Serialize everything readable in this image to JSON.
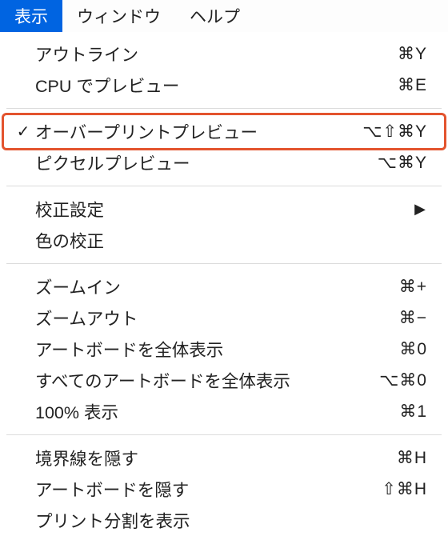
{
  "menubar": {
    "items": [
      {
        "label": "表示",
        "active": true
      },
      {
        "label": "ウィンドウ",
        "active": false
      },
      {
        "label": "ヘルプ",
        "active": false
      }
    ]
  },
  "menu": {
    "groups": [
      [
        {
          "label": "アウトライン",
          "shortcut": "⌘Y"
        },
        {
          "label": "CPU でプレビュー",
          "shortcut": "⌘E"
        }
      ],
      [
        {
          "label": "オーバープリントプレビュー",
          "shortcut": "⌥⇧⌘Y",
          "checked": true,
          "highlight": true
        },
        {
          "label": "ピクセルプレビュー",
          "shortcut": "⌥⌘Y"
        }
      ],
      [
        {
          "label": "校正設定",
          "submenu": true
        },
        {
          "label": "色の校正"
        }
      ],
      [
        {
          "label": "ズームイン",
          "shortcut": "⌘+"
        },
        {
          "label": "ズームアウト",
          "shortcut": "⌘−"
        },
        {
          "label": "アートボードを全体表示",
          "shortcut": "⌘0"
        },
        {
          "label": "すべてのアートボードを全体表示",
          "shortcut": "⌥⌘0"
        },
        {
          "label": "100% 表示",
          "shortcut": "⌘1"
        }
      ],
      [
        {
          "label": "境界線を隠す",
          "shortcut": "⌘H"
        },
        {
          "label": "アートボードを隠す",
          "shortcut": "⇧⌘H"
        },
        {
          "label": "プリント分割を表示"
        }
      ]
    ]
  }
}
